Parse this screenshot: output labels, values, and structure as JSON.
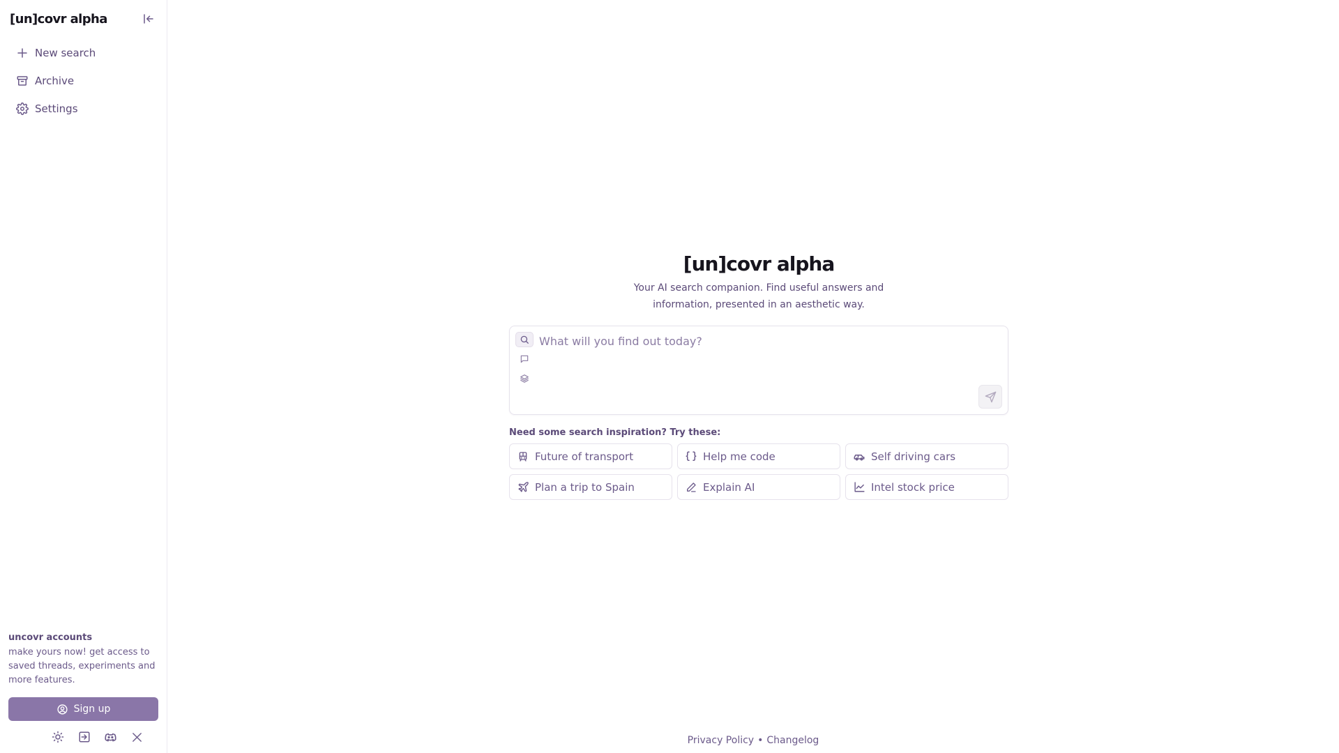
{
  "app": {
    "logo": "[un]covr alpha"
  },
  "sidebar": {
    "items": [
      {
        "label": "New search",
        "icon": "plus-icon"
      },
      {
        "label": "Archive",
        "icon": "archive-icon"
      },
      {
        "label": "Settings",
        "icon": "gear-icon"
      }
    ],
    "accounts_title": "uncovr accounts",
    "accounts_text": "make yours now! get access to saved threads, experiments and more features.",
    "signup_label": "Sign up",
    "footer_icons": [
      "sun-icon",
      "login-icon",
      "discord-icon",
      "x-icon"
    ]
  },
  "main": {
    "logo": "[un]covr alpha",
    "tagline": "Your AI search companion. Find useful answers and information, presented in an aesthetic way.",
    "search": {
      "placeholder": "What will you find out today?",
      "value": ""
    },
    "inspiration_title": "Need some search inspiration? Try these:",
    "suggestions": [
      {
        "label": "Future of transport",
        "icon": "train-icon"
      },
      {
        "label": "Help me code",
        "icon": "braces-icon"
      },
      {
        "label": "Self driving cars",
        "icon": "car-icon"
      },
      {
        "label": "Plan a trip to Spain",
        "icon": "plane-icon"
      },
      {
        "label": "Explain AI",
        "icon": "pen-icon"
      },
      {
        "label": "Intel stock price",
        "icon": "chart-icon"
      }
    ]
  },
  "footer": {
    "privacy": "Privacy Policy",
    "separator": "•",
    "changelog": "Changelog"
  },
  "colors": {
    "accent": "#8a76a8",
    "text": "#5b4a78",
    "border": "#e6e2ec"
  }
}
